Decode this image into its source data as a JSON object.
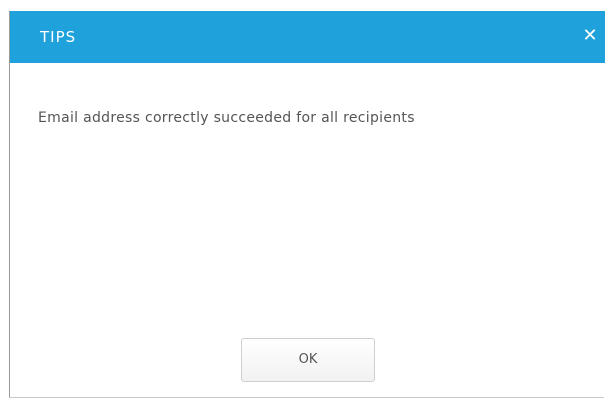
{
  "dialog": {
    "title": "TIPS",
    "close_glyph": "✕",
    "close_icon": "close-icon",
    "message": "Email address correctly succeeded for all recipients",
    "ok_label": "OK"
  },
  "colors": {
    "titlebar": "#1fa2dc",
    "title_text": "#ffffff",
    "body_text": "#555555",
    "button_border": "#cfcfcf"
  }
}
